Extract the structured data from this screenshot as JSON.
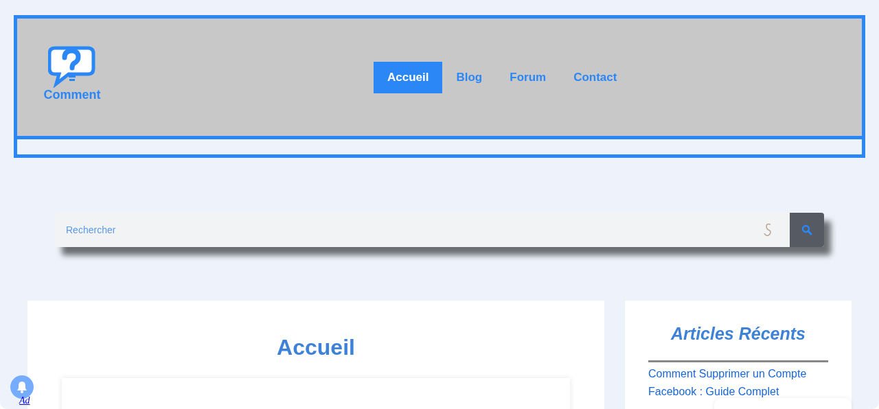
{
  "logo": {
    "text": "Comment"
  },
  "nav": [
    {
      "label": "Accueil",
      "selected": true
    },
    {
      "label": "Blog",
      "selected": false
    },
    {
      "label": "Forum",
      "selected": false
    },
    {
      "label": "Contact",
      "selected": false
    }
  ],
  "search": {
    "placeholder": "Rechercher"
  },
  "main": {
    "title": "Accueil"
  },
  "sidebar": {
    "title": "Articles Récents",
    "links": [
      "Comment Supprimer un Compte Facebook : Guide Complet"
    ]
  },
  "ad": {
    "label": "Ad"
  }
}
